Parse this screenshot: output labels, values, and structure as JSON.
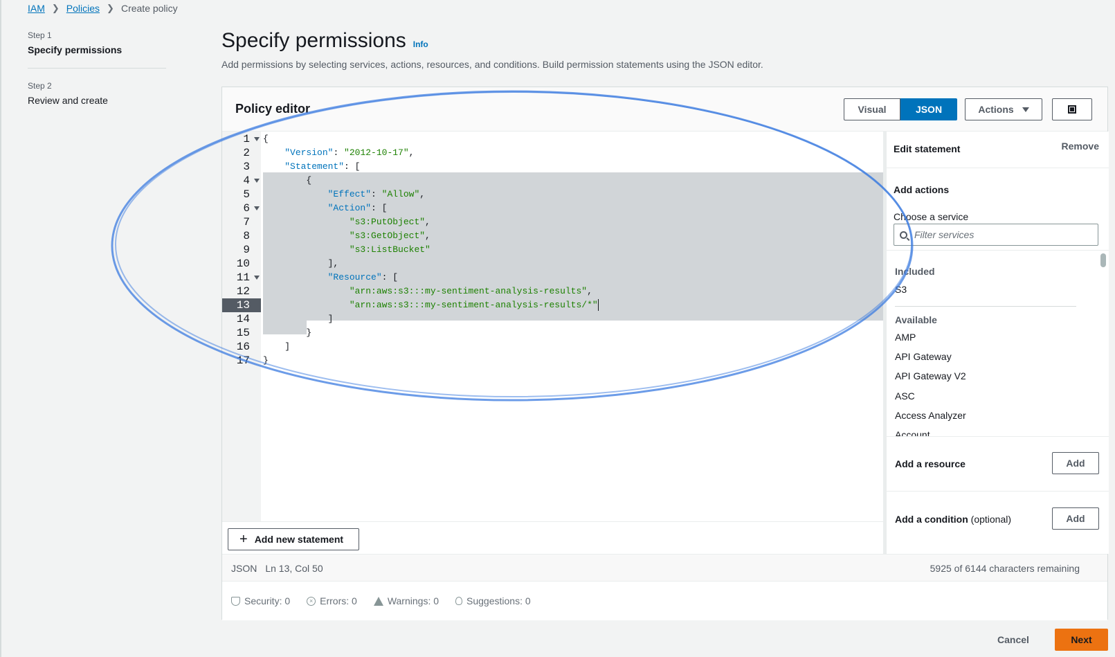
{
  "breadcrumb": {
    "root": "IAM",
    "policies": "Policies",
    "current": "Create policy"
  },
  "steps": [
    {
      "number": "Step 1",
      "title": "Specify permissions"
    },
    {
      "number": "Step 2",
      "title": "Review and create"
    }
  ],
  "header": {
    "title": "Specify permissions",
    "info": "Info",
    "description": "Add permissions by selecting services, actions, resources, and conditions. Build permission statements using the JSON editor."
  },
  "editor": {
    "title": "Policy editor",
    "tabs": [
      "Visual",
      "JSON"
    ],
    "selected_tab": "JSON",
    "actions_label": "Actions",
    "active_line": 13,
    "line_numbers": [
      "1",
      "2",
      "3",
      "4",
      "5",
      "6",
      "7",
      "8",
      "9",
      "10",
      "11",
      "12",
      "13",
      "14",
      "15",
      "16",
      "17"
    ],
    "code_lines": [
      "{",
      "    \"Version\": \"2012-10-17\",",
      "    \"Statement\": [",
      "        {",
      "            \"Effect\": \"Allow\",",
      "            \"Action\": [",
      "                \"s3:PutObject\",",
      "                \"s3:GetObject\",",
      "                \"s3:ListBucket\"",
      "            ],",
      "            \"Resource\": [",
      "                \"arn:aws:s3:::my-sentiment-analysis-results\",",
      "                \"arn:aws:s3:::my-sentiment-analysis-results/*\"",
      "            ]",
      "        }",
      "    ]",
      "}"
    ],
    "add_statement": "Add new statement"
  },
  "statement_panel": {
    "title": "Edit statement",
    "remove": "Remove",
    "add_actions": "Add actions",
    "choose_service": "Choose a service",
    "filter_placeholder": "Filter services",
    "included_label": "Included",
    "included": [
      "S3"
    ],
    "available_label": "Available",
    "available": [
      "AMP",
      "API Gateway",
      "API Gateway V2",
      "ASC",
      "Access Analyzer",
      "Account"
    ],
    "add_resource": "Add a resource",
    "add_condition": "Add a condition",
    "optional": "(optional)",
    "add_button": "Add"
  },
  "status": {
    "mode": "JSON",
    "position": "Ln 13, Col 50",
    "remaining": "5925 of 6144 characters remaining",
    "security": "Security: 0",
    "errors": "Errors: 0",
    "warnings": "Warnings: 0",
    "suggestions": "Suggestions: 0"
  },
  "footer": {
    "cancel": "Cancel",
    "next": "Next"
  },
  "colors": {
    "primary": "#0073bb",
    "accent": "#ec7211",
    "string": "#1d8102",
    "annotation": "#3b7be0"
  },
  "icons": [
    "chevron-right-icon",
    "caret-down-icon",
    "split-panel-icon",
    "fold-icon",
    "plus-icon",
    "search-icon",
    "shield-icon",
    "error-icon",
    "warning-icon",
    "bulb-icon"
  ]
}
